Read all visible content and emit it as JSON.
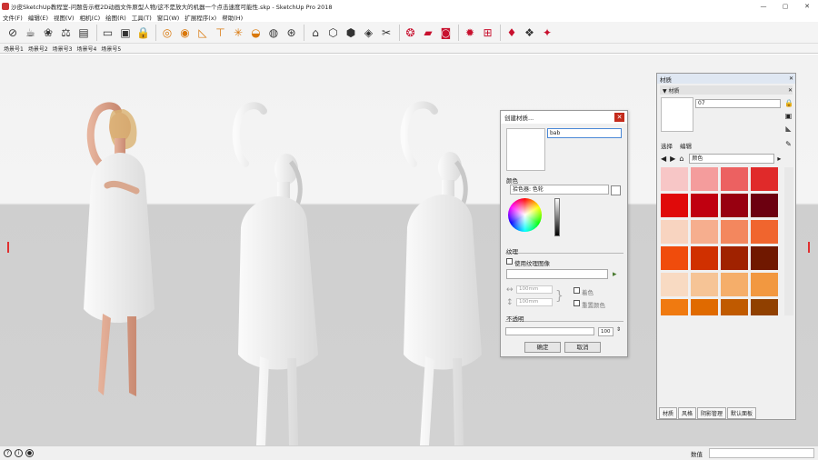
{
  "window": {
    "title": "沙皮SketchUp教程室-问题告示框2D动画文件原型人物/这不是放大的机器一个点击速度可能性.skp - SketchUp Pro 2018",
    "minimize_glyph": "—",
    "maximize_glyph": "▢",
    "close_glyph": "✕"
  },
  "menu": [
    "文件(F)",
    "编辑(E)",
    "视图(V)",
    "相机(C)",
    "绘图(R)",
    "工具(T)",
    "窗口(W)",
    "扩展程序(x)",
    "帮助(H)"
  ],
  "scene_tabs": [
    "场景号1",
    "场景号2",
    "场景号3",
    "场景号4",
    "场景号5"
  ],
  "status": {
    "label": "数值",
    "value": ""
  },
  "materials_panel": {
    "title": "材质",
    "section": "▼ 材质",
    "material_name": "07",
    "tabs": [
      "选择",
      "编辑"
    ],
    "library": "颜色",
    "bottom_tabs": [
      "材质",
      "风格",
      "阴影管理",
      "默认面板"
    ],
    "swatch_colors": [
      "#f7c6c6",
      "#f49c9c",
      "#ec6161",
      "#e02a2a",
      "#e00a0a",
      "#c00010",
      "#980010",
      "#6c0010",
      "#f8d4c0",
      "#f6ae8e",
      "#f3875e",
      "#f0652e",
      "#f04c0c",
      "#d03000",
      "#a02200",
      "#701800",
      "#f8dac2",
      "#f6c496",
      "#f5ae6a",
      "#f29840",
      "#f07a10",
      "#e06a00",
      "#c05a00",
      "#904000"
    ]
  },
  "create_dialog": {
    "title": "创建材质...",
    "name_value": "bab",
    "color_heading": "颜色",
    "picker_label": "拾色器: 色轮",
    "texture_heading": "纹理",
    "use_texture_label": "使用纹理图像",
    "width_value": "100mm",
    "height_value": "100mm",
    "colorize_label": "着色",
    "reset_label": "重置颜色",
    "opacity_heading": "不透明",
    "opacity_value": "100",
    "ok_label": "确定",
    "cancel_label": "取消"
  }
}
